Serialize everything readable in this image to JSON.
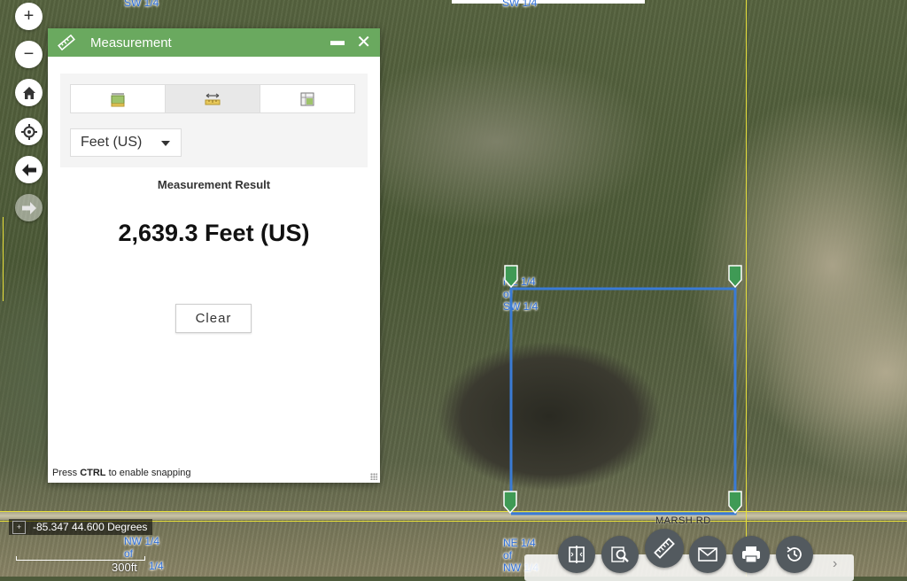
{
  "panel": {
    "title": "Measurement",
    "tabs": [
      {
        "name": "area",
        "icon": "area-measure-icon"
      },
      {
        "name": "distance",
        "icon": "distance-measure-icon",
        "active": true
      },
      {
        "name": "location",
        "icon": "location-measure-icon"
      }
    ],
    "unit": "Feet (US)",
    "result_label": "Measurement Result",
    "result_value": "2,639.3 Feet (US)",
    "clear_label": "Clear",
    "snap_hint_prefix": "Press ",
    "snap_hint_key": "CTRL",
    "snap_hint_suffix": " to enable snapping"
  },
  "map": {
    "coordinates": "-85.347 44.600 Degrees",
    "scale": "300ft",
    "labels": {
      "sw_top": "SW 1/4",
      "ne_line1": "NE 1/4",
      "ne_line2": "of",
      "ne_line3": "SW 1/4",
      "nw_bottom_line1": "NW 1/4",
      "nw_bottom_line2": "of",
      "nw_bottom_line3": "1/4",
      "ne_bottom_line1": "NE 1/4",
      "ne_bottom_line2": "of",
      "ne_bottom_line3": "NW 1/4",
      "road": "MARSH RD"
    },
    "measure_color": "#3a7bd5",
    "marker_color": "#3f9a55"
  },
  "colors": {
    "header": "#6aa95f",
    "toolbar_button": "#535a5f"
  }
}
